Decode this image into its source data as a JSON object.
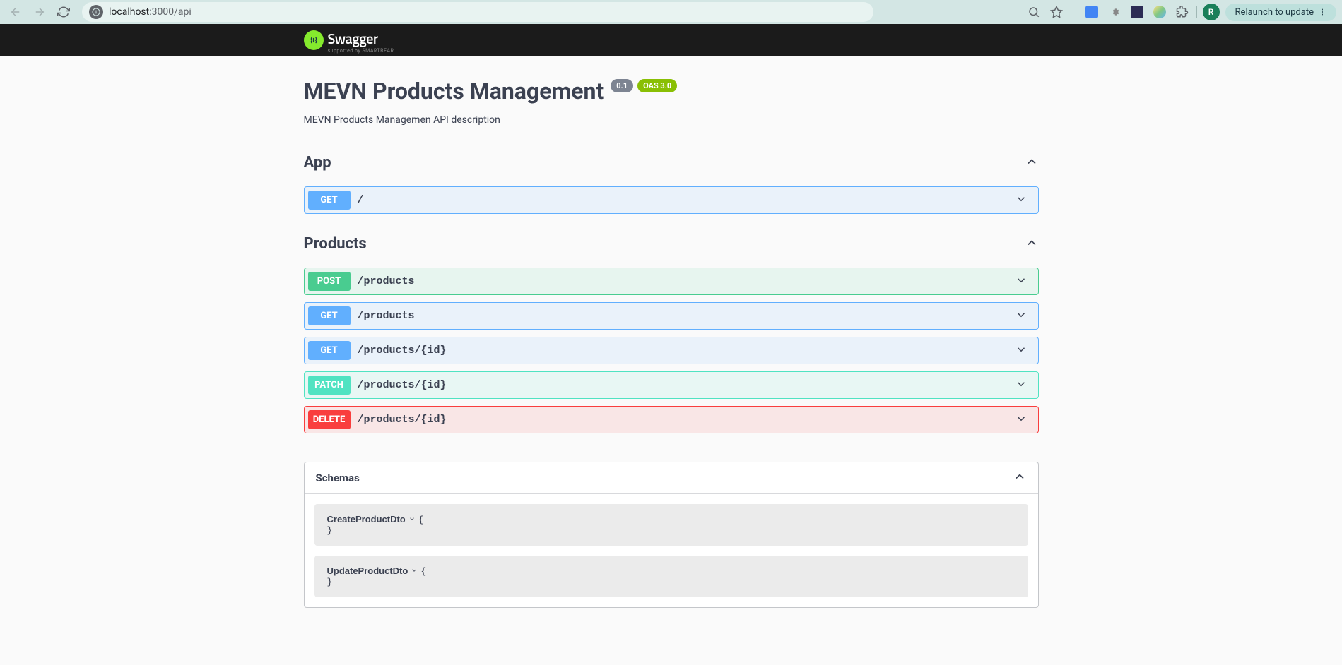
{
  "browser": {
    "url_host": "localhost",
    "url_port": ":3000",
    "url_path": "/api",
    "relaunch": "Relaunch to update",
    "avatar": "R"
  },
  "logo": {
    "name": "Swagger",
    "sponsor": "supported by SMARTBEAR"
  },
  "info": {
    "title": "MEVN Products Management",
    "version": "0.1",
    "oas": "OAS 3.0",
    "description": "MEVN Products Managemen API description"
  },
  "tags": [
    {
      "name": "App",
      "operations": [
        {
          "method": "GET",
          "class": "get",
          "path": "/"
        }
      ]
    },
    {
      "name": "Products",
      "operations": [
        {
          "method": "POST",
          "class": "post",
          "path": "/products"
        },
        {
          "method": "GET",
          "class": "get",
          "path": "/products"
        },
        {
          "method": "GET",
          "class": "get",
          "path": "/products/{id}"
        },
        {
          "method": "PATCH",
          "class": "patch",
          "path": "/products/{id}"
        },
        {
          "method": "DELETE",
          "class": "delete",
          "path": "/products/{id}"
        }
      ]
    }
  ],
  "schemas": {
    "title": "Schemas",
    "models": [
      {
        "name": "CreateProductDto",
        "open": "{",
        "close": "}"
      },
      {
        "name": "UpdateProductDto",
        "open": "{",
        "close": "}"
      }
    ]
  }
}
